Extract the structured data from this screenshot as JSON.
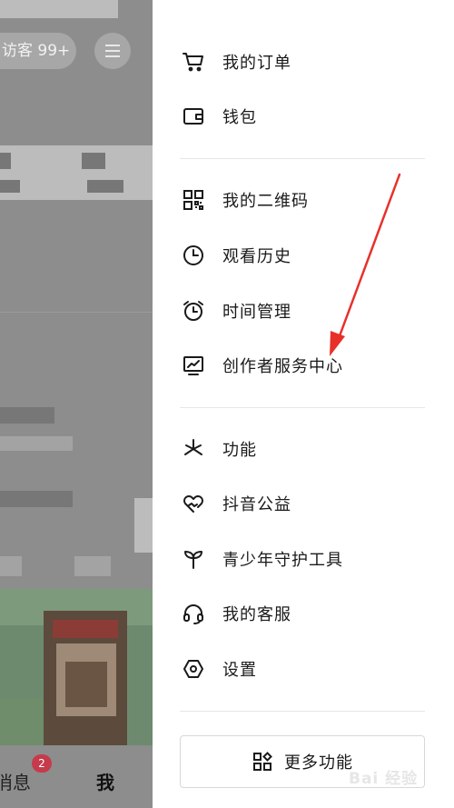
{
  "background": {
    "visitor_text": "访客 99+",
    "tabs": {
      "messages_label": "消息",
      "messages_badge": "2",
      "me_label": "我"
    }
  },
  "drawer": {
    "groups": [
      [
        {
          "label": "我的订单",
          "icon": "cart-icon"
        },
        {
          "label": "钱包",
          "icon": "wallet-icon"
        }
      ],
      [
        {
          "label": "我的二维码",
          "icon": "qr-code-icon"
        },
        {
          "label": "观看历史",
          "icon": "clock-icon"
        },
        {
          "label": "时间管理",
          "icon": "alarm-clock-icon"
        },
        {
          "label": "创作者服务中心",
          "icon": "monitor-chart-icon"
        }
      ],
      [
        {
          "label": "功能",
          "icon": "features-icon"
        },
        {
          "label": "抖音公益",
          "icon": "heart-charity-icon"
        },
        {
          "label": "青少年守护工具",
          "icon": "sprout-icon"
        },
        {
          "label": "我的客服",
          "icon": "headset-icon"
        },
        {
          "label": "设置",
          "icon": "hexagon-settings-icon"
        }
      ]
    ],
    "more_button_label": "更多功能"
  },
  "annotation": {
    "arrow_color": "#e8302a"
  },
  "watermark_text": "Bai 经验"
}
